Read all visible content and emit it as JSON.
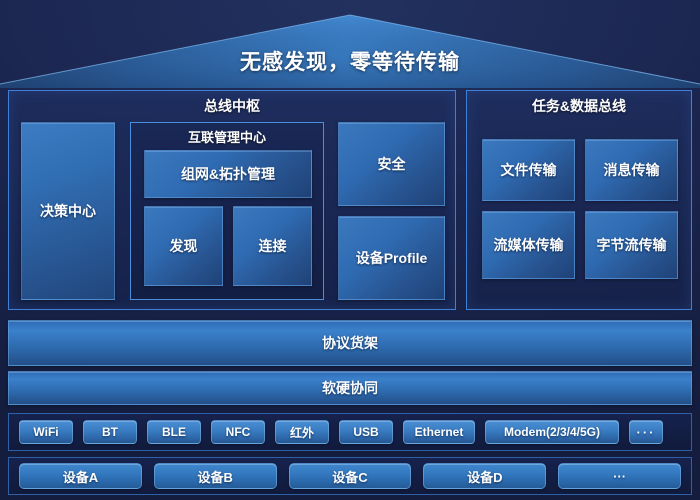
{
  "header": {
    "title": "无感发现，零等待传输",
    "roof_icon": "roof-triangle"
  },
  "bus_hub": {
    "title": "总线中枢",
    "decision_center": "决策中心",
    "interconnect": {
      "title": "互联管理中心",
      "items": [
        "组网&拓扑管理",
        "发现",
        "连接"
      ]
    },
    "right_column": [
      "安全",
      "设备Profile"
    ]
  },
  "task_data_bus": {
    "title": "任务&数据总线",
    "items": [
      "文件传输",
      "消息传输",
      "流媒体传输",
      "字节流传输"
    ]
  },
  "layers": [
    "协议货架",
    "软硬协同"
  ],
  "protocols": [
    "WiFi",
    "BT",
    "BLE",
    "NFC",
    "红外",
    "USB",
    "Ethernet",
    "Modem(2/3/4/5G)",
    "···"
  ],
  "devices": [
    "设备A",
    "设备B",
    "设备C",
    "设备D",
    "···"
  ],
  "colors": {
    "background": "#1b2650",
    "panel_border": "#3f7fd6",
    "subpanel_border": "#4d8ddd",
    "block_blue": "#3176b9",
    "roof_blue": "#2f6cae",
    "text": "#ffffff"
  }
}
